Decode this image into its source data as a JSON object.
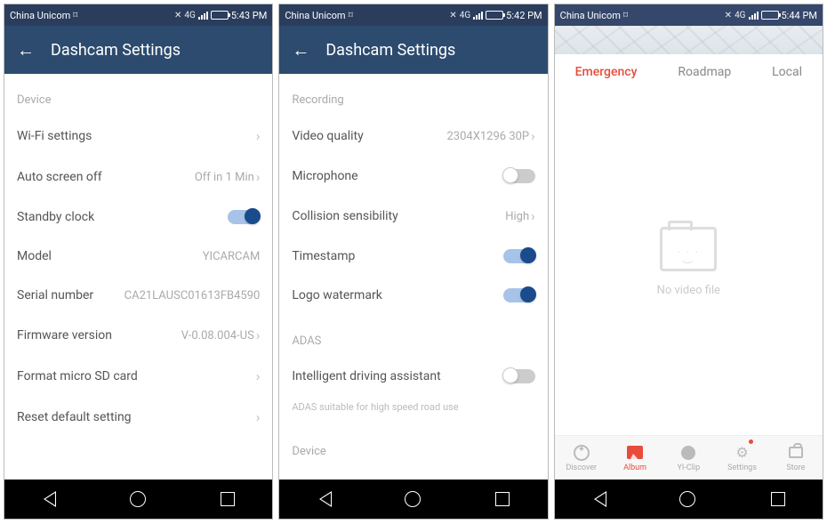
{
  "phones": [
    {
      "status": {
        "carrier": "China Unicom",
        "time": "5:43 PM"
      },
      "header": {
        "title": "Dashcam Settings"
      },
      "section_device": "Device",
      "rows": {
        "wifi": "Wi-Fi settings",
        "auto_screen_off": {
          "label": "Auto screen off",
          "value": "Off in 1 Min"
        },
        "standby_clock": "Standby clock",
        "model": {
          "label": "Model",
          "value": "YICARCAM"
        },
        "serial": {
          "label": "Serial number",
          "value": "CA21LAUSC01613FB4590"
        },
        "firmware": {
          "label": "Firmware version",
          "value": "V-0.08.004-US"
        },
        "format_sd": "Format micro SD card",
        "reset": "Reset default setting"
      }
    },
    {
      "status": {
        "carrier": "China Unicom",
        "time": "5:42 PM"
      },
      "header": {
        "title": "Dashcam Settings"
      },
      "section_recording": "Recording",
      "rows": {
        "video_quality": {
          "label": "Video quality",
          "value": "2304X1296 30P"
        },
        "microphone": "Microphone",
        "collision": {
          "label": "Collision sensibility",
          "value": "High"
        },
        "timestamp": "Timestamp",
        "logo_watermark": "Logo watermark"
      },
      "section_adas": "ADAS",
      "adas_row": "Intelligent driving assistant",
      "adas_hint": "ADAS suitable for high speed road use",
      "section_device": "Device"
    },
    {
      "status": {
        "carrier": "China Unicom",
        "time": "5:44 PM"
      },
      "tabs": {
        "emergency": "Emergency",
        "roadmap": "Roadmap",
        "local": "Local"
      },
      "empty": "No video file",
      "bottom": {
        "discover": "Discover",
        "album": "Album",
        "yiclip": "YI-Clip",
        "settings": "Settings",
        "store": "Store"
      }
    }
  ]
}
